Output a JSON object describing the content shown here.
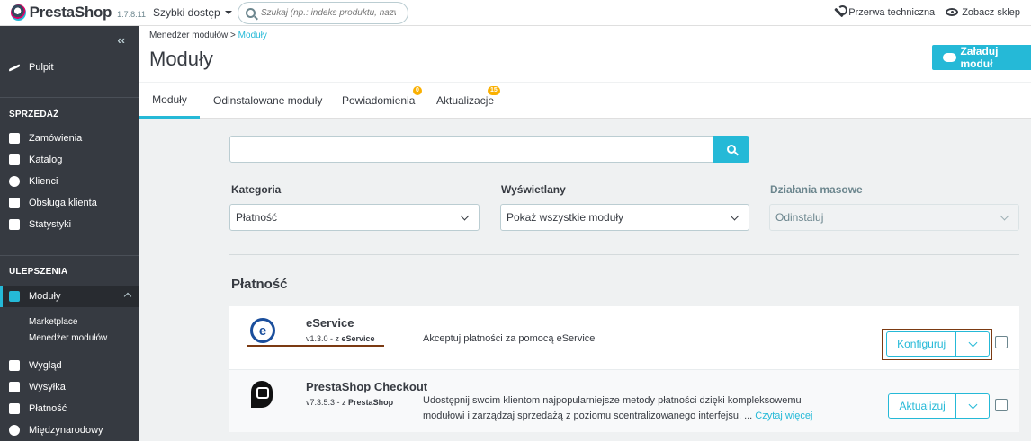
{
  "header": {
    "brand": "PrestaShop",
    "version": "1.7.8.11",
    "quick_access": "Szybki dostęp",
    "search_placeholder": "Szukaj (np.: indeks produktu, nazwa k",
    "maintenance": "Przerwa techniczna",
    "view_shop": "Zobacz sklep"
  },
  "sidebar": {
    "collapse": "‹‹",
    "dashboard": "Pulpit",
    "section_sales": "SPRZEDAŻ",
    "orders": "Zamówienia",
    "catalog": "Katalog",
    "customers": "Klienci",
    "customer_service": "Obsługa klienta",
    "stats": "Statystyki",
    "section_improve": "ULEPSZENIA",
    "modules": "Moduły",
    "marketplace": "Marketplace",
    "module_manager": "Menedżer modułów",
    "appearance": "Wygląd",
    "shipping": "Wysyłka",
    "payment": "Płatność",
    "international": "Międzynarodowy"
  },
  "page": {
    "breadcrumb_parent": "Menedżer modułów",
    "breadcrumb_sep": ">",
    "breadcrumb_current": "Moduły",
    "title": "Moduły",
    "upload_button": "Załaduj moduł"
  },
  "tabs": [
    {
      "label": "Moduły"
    },
    {
      "label": "Odinstalowane moduły"
    },
    {
      "label": "Powiadomienia",
      "badge": "0"
    },
    {
      "label": "Aktualizacje",
      "badge": "15"
    }
  ],
  "filters": {
    "category_label": "Kategoria",
    "category_value": "Płatność",
    "display_label": "Wyświetlany",
    "display_value": "Pokaż wszystkie moduły",
    "bulk_label": "Działania masowe",
    "bulk_value": "Odinstaluj"
  },
  "category_title": "Płatność",
  "modules": [
    {
      "name": "eService",
      "version": "v1.3.0 - z",
      "author": "eService",
      "description": "Akceptuj płatności za pomocą eService",
      "action": "Konfiguruj"
    },
    {
      "name": "PrestaShop Checkout",
      "version": "v7.3.5.3 - z",
      "author": "PrestaShop",
      "description": "Udostępnij swoim klientom najpopularniejsze metody płatności dzięki kompleksowemu modułowi i zarządzaj sprzedażą z poziomu scentralizowanego interfejsu. ...",
      "read_more": "Czytaj więcej",
      "action": "Aktualizuj"
    }
  ],
  "colors": {
    "accent": "#25b9d7",
    "sidebar": "#363a41",
    "badge": "#fab000"
  }
}
